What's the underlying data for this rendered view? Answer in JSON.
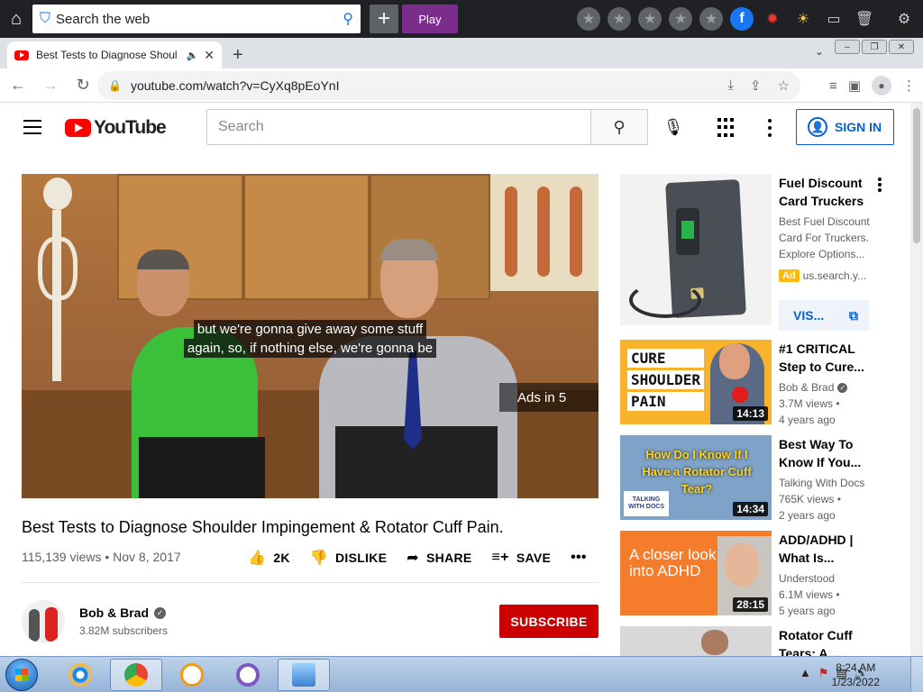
{
  "browser": {
    "search_placeholder": "Search the web",
    "play_label": "Play",
    "tab_title": "Best Tests to Diagnose Shoul",
    "url": "youtube.com/watch?v=CyXq8pEoYnI"
  },
  "youtube": {
    "logo_text": "YouTube",
    "search_placeholder": "Search",
    "sign_in_label": "SIGN IN"
  },
  "player": {
    "caption_line_1": "but we're gonna give away some stuff",
    "caption_line_2": "again, so, if nothing else, we're gonna be",
    "ads_countdown": "Ads in 5"
  },
  "video": {
    "title": "Best Tests to Diagnose Shoulder Impingement & Rotator Cuff Pain.",
    "meta": "115,139 views • Nov 8, 2017",
    "like_count": "2K",
    "dislike_label": "DISLIKE",
    "share_label": "SHARE",
    "save_label": "SAVE"
  },
  "channel": {
    "name": "Bob & Brad",
    "subscribers": "3.82M subscribers",
    "subscribe_label": "SUBSCRIBE"
  },
  "ad": {
    "title": "Fuel Discount Card Truckers",
    "description": "Best Fuel Discount Card For Truckers. Explore Options...",
    "badge": "Ad",
    "domain": "us.search.y...",
    "visit_label": "VIS..."
  },
  "related": [
    {
      "title": "#1 CRITICAL Step to Cure...",
      "channel": "Bob & Brad",
      "views": "3.7M views •",
      "age": "4 years ago",
      "duration": "14:13",
      "thumb_lines": [
        "CURE",
        "SHOULDER",
        "PAIN"
      ]
    },
    {
      "title": "Best Way To Know If You...",
      "channel": "Talking With Docs",
      "views": "765K views •",
      "age": "2 years ago",
      "duration": "14:34",
      "thumb_text": "How Do I Know If I Have a Rotator Cuff Tear?",
      "thumb_logo": "TALKING WITH DOCS"
    },
    {
      "title": "ADD/ADHD | What Is...",
      "channel": "Understood",
      "views": "6.1M views •",
      "age": "5 years ago",
      "duration": "28:15",
      "thumb_text": "A closer look into ADHD"
    },
    {
      "title": "Rotator Cuff Tears: A..."
    }
  ],
  "taskbar": {
    "time": "8:24 AM",
    "date": "1/23/2022"
  },
  "colors": {
    "youtube_red": "#ff0000",
    "subscribe_red": "#cc0000",
    "link_blue": "#065fd4",
    "play_purple": "#7b2d8e"
  }
}
